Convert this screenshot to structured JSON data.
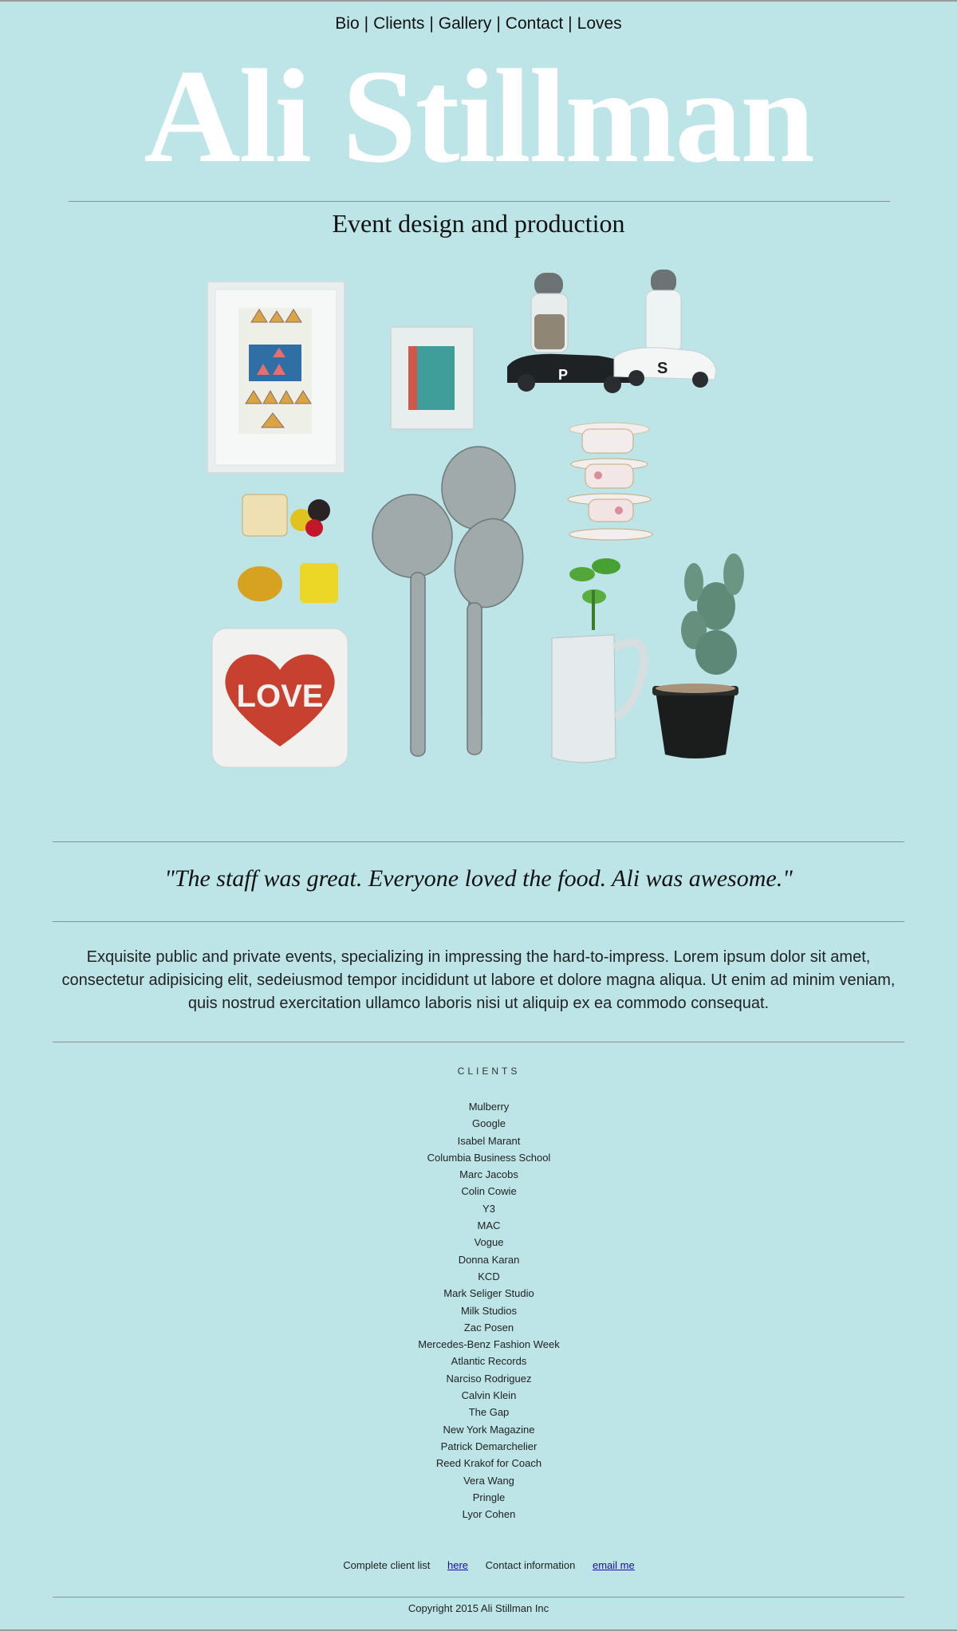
{
  "nav": {
    "items": [
      "Bio",
      "Clients",
      "Gallery",
      "Contact",
      "Loves"
    ],
    "separator": "|"
  },
  "header": {
    "title": "Ali Stillman",
    "tagline": "Event design and production"
  },
  "quote": "\"The staff was great. Everyone loved the food. Ali was awesome.\"",
  "description": "Exquisite public and private events, specializing in impressing the hard-to-impress. Lorem ipsum dolor sit amet, consectetur adipisicing elit, sedeiusmod tempor incididunt ut labore et dolore magna aliqua. Ut enim ad minim veniam, quis nostrud exercitation ullamco laboris nisi ut aliquip ex ea commodo consequat.",
  "clients": {
    "heading": "CLIENTS",
    "items": [
      "Mulberry",
      "Google",
      "Isabel Marant",
      "Columbia Business School",
      "Marc Jacobs",
      "Colin Cowie",
      "Y3",
      "MAC",
      "Vogue",
      "Donna Karan",
      "KCD",
      "Mark Seliger Studio",
      "Milk Studios",
      "Zac Posen",
      "Mercedes-Benz Fashion Week",
      "Atlantic Records",
      "Narciso Rodriguez",
      "Calvin Klein",
      "The Gap",
      "New York Magazine",
      "Patrick Demarchelier",
      "Reed Krakof for Coach",
      "Vera Wang",
      "Pringle",
      "Lyor Cohen"
    ]
  },
  "footer": {
    "client_list_label": "Complete client list",
    "client_list_link": "here",
    "contact_label": "Contact information",
    "contact_link": "email me",
    "copyright": "Copyright 2015 Ali Stillman Inc"
  },
  "collage": {
    "love_pillow_text": "LOVE",
    "car_letters": [
      "P",
      "S"
    ]
  },
  "colors": {
    "background": "#bde4e6",
    "title": "#ffffff",
    "link": "#1a0dab",
    "pillow_heart": "#c8402f"
  }
}
